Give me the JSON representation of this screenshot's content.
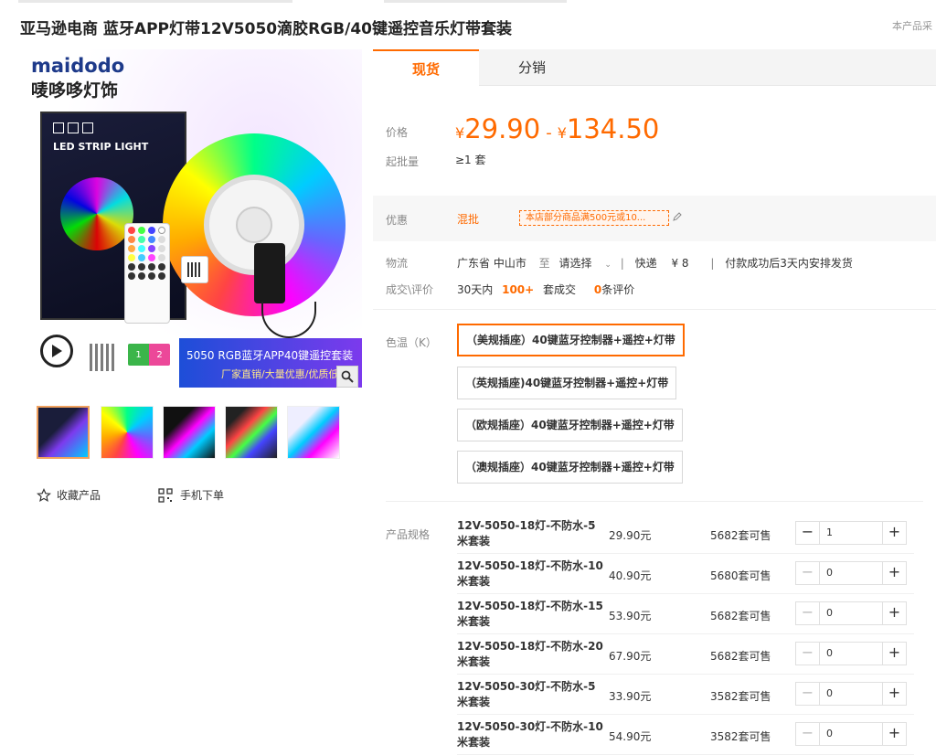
{
  "title": "亚马逊电商 蓝牙APP灯带12V5050滴胶RGB/40键遥控音乐灯带套装",
  "top_right": "本产品采",
  "gallery": {
    "brand_en": "maidodo",
    "brand_cn": "唛哆哆灯饰",
    "box_label": "LED STRIP LIGHT",
    "banner_line1": "5050 RGB蓝牙APP40键遥控套装",
    "banner_line2": "厂家直销/大量优惠/优质低",
    "connector_labels": [
      "1",
      "2"
    ]
  },
  "actions": {
    "favorite": "收藏产品",
    "mobile_order": "手机下单"
  },
  "tabs": [
    "现货",
    "分销"
  ],
  "price": {
    "label": "价格",
    "currency": "¥",
    "low": "29.90",
    "separator": "-",
    "high": "134.50",
    "min_batch_label": "起批量",
    "min_batch_value": "≥1 套"
  },
  "promo": {
    "label": "优惠",
    "type": "混批",
    "coupon_text": "本店部分商品满500元或10...",
    "edit_icon": "pencil-icon"
  },
  "logistics": {
    "label": "物流",
    "origin": "广东省 中山市",
    "to": "至",
    "dest": "请选择",
    "express": "快递",
    "fee": "¥ 8",
    "ship_note": "付款成功后3天内安排发货",
    "deal_label": "成交\\评价",
    "period": "30天内",
    "deals": "100+",
    "deals_suffix": "套成交",
    "reviews": "0",
    "reviews_suffix": "条评价"
  },
  "color": {
    "label": "色温（K）",
    "options": [
      "（美规插座）40键蓝牙控制器+遥控+灯带",
      "（英规插座)40键蓝牙控制器+遥控+灯带",
      "（欧规插座）40键蓝牙控制器+遥控+灯带",
      "（澳规插座）40键蓝牙控制器+遥控+灯带"
    ],
    "selected": 0
  },
  "specs": {
    "label": "产品规格",
    "rows": [
      {
        "name": "12V-5050-18灯-不防水-5米套装",
        "price": "29.90元",
        "stock": "5682套可售",
        "qty": "1"
      },
      {
        "name": "12V-5050-18灯-不防水-10米套装",
        "price": "40.90元",
        "stock": "5680套可售",
        "qty": "0"
      },
      {
        "name": "12V-5050-18灯-不防水-15米套装",
        "price": "53.90元",
        "stock": "5682套可售",
        "qty": "0"
      },
      {
        "name": "12V-5050-18灯-不防水-20米套装",
        "price": "67.90元",
        "stock": "5682套可售",
        "qty": "0"
      },
      {
        "name": "12V-5050-30灯-不防水-5米套装",
        "price": "33.90元",
        "stock": "3582套可售",
        "qty": "0"
      },
      {
        "name": "12V-5050-30灯-不防水-10米套装",
        "price": "54.90元",
        "stock": "3582套可售",
        "qty": "0"
      }
    ],
    "minus": "−",
    "plus": "+"
  },
  "colors": {
    "accent": "#ff6a00",
    "selected_border": "#ff6a00",
    "thumb_active": "#f0a15e"
  }
}
